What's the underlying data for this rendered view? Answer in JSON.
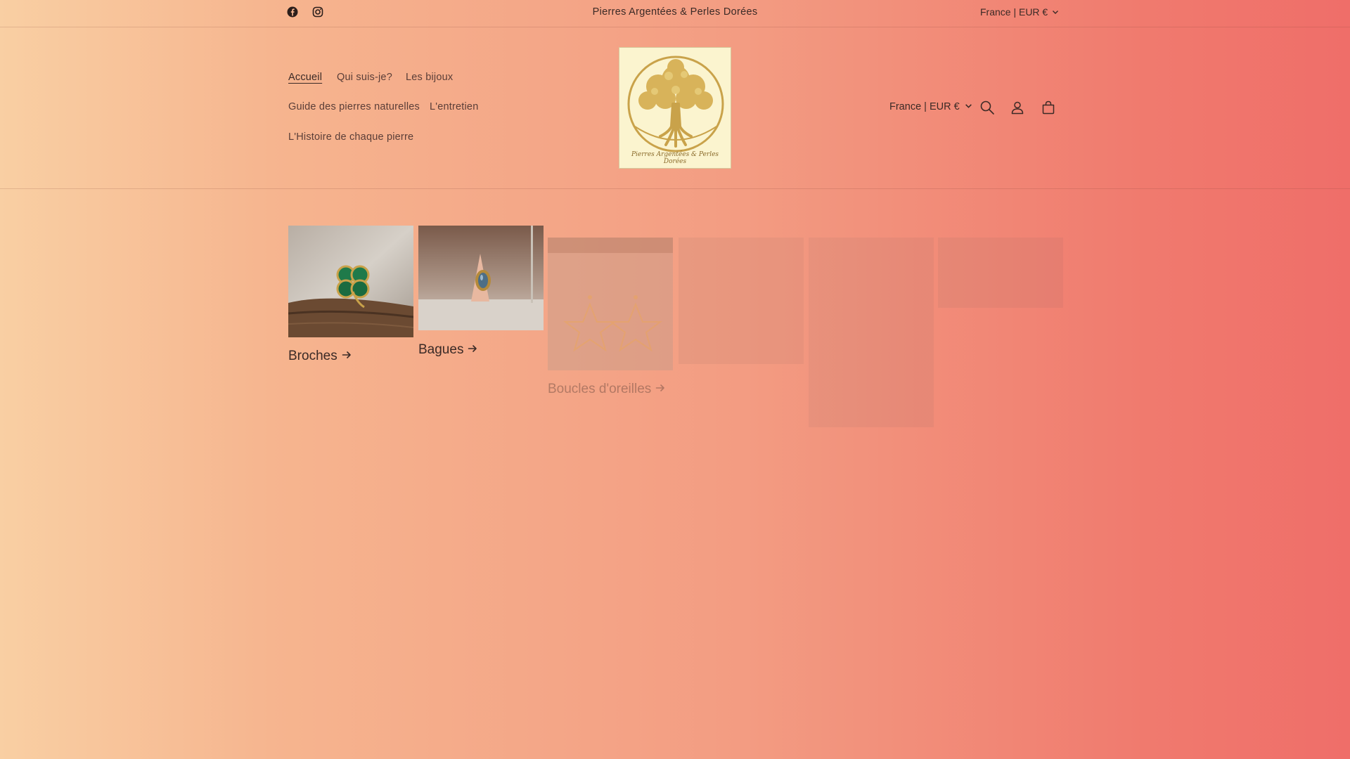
{
  "announcement": {
    "text": "Pierres Argentées & Perles Dorées"
  },
  "social": [
    {
      "icon": "facebook-icon"
    },
    {
      "icon": "instagram-icon"
    }
  ],
  "country_selector_top": {
    "label": "France | EUR €"
  },
  "nav": {
    "items": [
      {
        "label": "Accueil",
        "active": true
      },
      {
        "label": "Qui suis-je?"
      },
      {
        "label": "Les bijoux"
      },
      {
        "label": "Guide des pierres naturelles"
      },
      {
        "label": "L'entretien"
      },
      {
        "label": "L'Histoire de chaque pierre"
      }
    ]
  },
  "logo": {
    "caption": "Pierres Argentées & Perles Dorées"
  },
  "header": {
    "country_selector": "France | EUR €",
    "icons": [
      "search-icon",
      "account-icon",
      "cart-icon"
    ]
  },
  "collections": [
    {
      "title": "Broches"
    },
    {
      "title": "Bagues"
    },
    {
      "title": "Boucles d'oreilles"
    }
  ],
  "colors": {
    "gradient_start": "#f9cfa3",
    "gradient_end": "#ef6e69",
    "text": "#3b2a26",
    "logo_gold": "#c9a24a"
  }
}
